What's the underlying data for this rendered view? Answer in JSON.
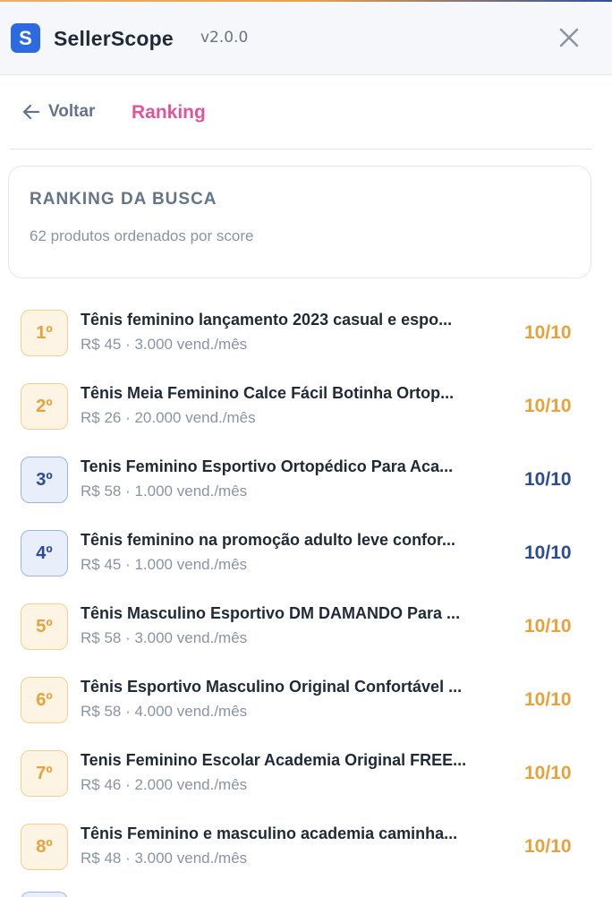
{
  "header": {
    "app_name": "SellerScope",
    "version": "v2.0.0",
    "logo_letter": "S",
    "brand_color": "#2d6ae0"
  },
  "nav": {
    "back_label": "Voltar",
    "title": "Ranking",
    "title_color": "#e0559a"
  },
  "summary": {
    "title": "RANKING DA BUSCA",
    "subtitle": "62 produtos ordenados por score"
  },
  "products": [
    {
      "rank": "1º",
      "title": "Tênis feminino lançamento 2023 casual e espo...",
      "meta": "R$ 45 · 3.000 vend./mês",
      "score": "10/10",
      "tier": "gold"
    },
    {
      "rank": "2º",
      "title": "Tênis Meia Feminino Calce Fácil Botinha Ortop...",
      "meta": "R$ 26 · 20.000 vend./mês",
      "score": "10/10",
      "tier": "gold"
    },
    {
      "rank": "3º",
      "title": "Tenis Feminino Esportivo Ortopédico Para Aca...",
      "meta": "R$ 58 · 1.000 vend./mês",
      "score": "10/10",
      "tier": "blue"
    },
    {
      "rank": "4º",
      "title": "Tênis feminino na promoção adulto leve confor...",
      "meta": "R$ 45 · 1.000 vend./mês",
      "score": "10/10",
      "tier": "blue"
    },
    {
      "rank": "5º",
      "title": "Tênis Masculino Esportivo DM DAMANDO Para ...",
      "meta": "R$ 58 · 3.000 vend./mês",
      "score": "10/10",
      "tier": "gold"
    },
    {
      "rank": "6º",
      "title": "Tênis Esportivo Masculino Original Confortável ...",
      "meta": "R$ 58 · 4.000 vend./mês",
      "score": "10/10",
      "tier": "gold"
    },
    {
      "rank": "7º",
      "title": "Tenis Feminino Escolar Academia Original FREE...",
      "meta": "R$ 46 · 2.000 vend./mês",
      "score": "10/10",
      "tier": "gold"
    },
    {
      "rank": "8º",
      "title": "Tênis Feminino e masculino academia caminha...",
      "meta": "R$ 48 · 3.000 vend./mês",
      "score": "10/10",
      "tier": "gold"
    }
  ],
  "colors": {
    "gold": "#e8a23c",
    "blue": "#2c4c95"
  },
  "icons": {
    "close": "close-icon",
    "back": "arrow-left-icon"
  }
}
